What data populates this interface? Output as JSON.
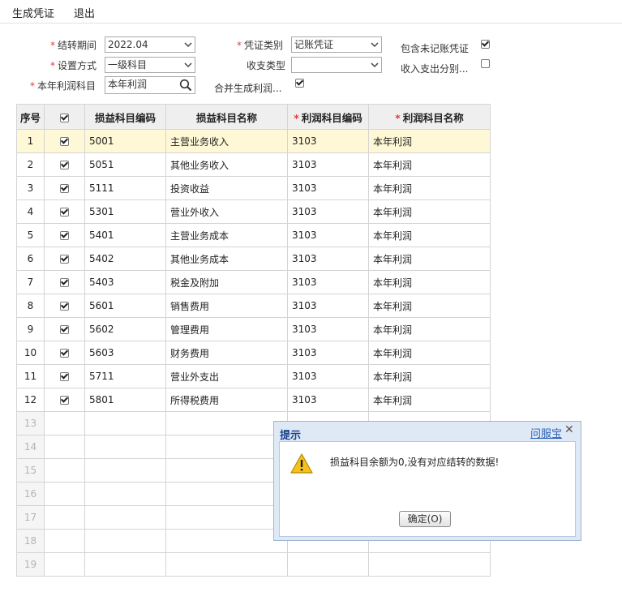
{
  "toolbar": {
    "generate": "生成凭证",
    "exit": "退出"
  },
  "form": {
    "period_label": "结转期间",
    "period_value": "2022.04",
    "voucher_type_label": "凭证类别",
    "voucher_type_value": "记账凭证",
    "include_unposted_label": "包含未记账凭证",
    "include_unposted_checked": true,
    "setting_mode_label": "设置方式",
    "setting_mode_value": "一级科目",
    "income_type_label": "收支类型",
    "income_type_value": "",
    "income_expense_split_label": "收入支出分别...",
    "income_expense_split_checked": false,
    "profit_account_label": "本年利润科目",
    "profit_account_value": "本年利润",
    "merge_label": "合并生成利润...",
    "merge_checked": true
  },
  "table": {
    "headers": {
      "seq": "序号",
      "pl_code": "损益科目编码",
      "pl_name": "损益科目名称",
      "profit_code": "利润科目编码",
      "profit_name": "利润科目名称"
    },
    "rows": [
      {
        "seq": "1",
        "code": "5001",
        "name": "主营业务收入",
        "pcode": "3103",
        "pname": "本年利润"
      },
      {
        "seq": "2",
        "code": "5051",
        "name": "其他业务收入",
        "pcode": "3103",
        "pname": "本年利润"
      },
      {
        "seq": "3",
        "code": "5111",
        "name": "投资收益",
        "pcode": "3103",
        "pname": "本年利润"
      },
      {
        "seq": "4",
        "code": "5301",
        "name": "营业外收入",
        "pcode": "3103",
        "pname": "本年利润"
      },
      {
        "seq": "5",
        "code": "5401",
        "name": "主营业务成本",
        "pcode": "3103",
        "pname": "本年利润"
      },
      {
        "seq": "6",
        "code": "5402",
        "name": "其他业务成本",
        "pcode": "3103",
        "pname": "本年利润"
      },
      {
        "seq": "7",
        "code": "5403",
        "name": "税金及附加",
        "pcode": "3103",
        "pname": "本年利润"
      },
      {
        "seq": "8",
        "code": "5601",
        "name": "销售费用",
        "pcode": "3103",
        "pname": "本年利润"
      },
      {
        "seq": "9",
        "code": "5602",
        "name": "管理费用",
        "pcode": "3103",
        "pname": "本年利润"
      },
      {
        "seq": "10",
        "code": "5603",
        "name": "财务费用",
        "pcode": "3103",
        "pname": "本年利润"
      },
      {
        "seq": "11",
        "code": "5711",
        "name": "营业外支出",
        "pcode": "3103",
        "pname": "本年利润"
      },
      {
        "seq": "12",
        "code": "5801",
        "name": "所得税费用",
        "pcode": "3103",
        "pname": "本年利润"
      }
    ],
    "empty_rows": [
      "13",
      "14",
      "15",
      "16",
      "17",
      "18",
      "19"
    ]
  },
  "dialog": {
    "title": "提示",
    "help": "问服宝",
    "message": "损益科目余额为0,没有对应结转的数据!",
    "ok_button": "确定(O)"
  }
}
